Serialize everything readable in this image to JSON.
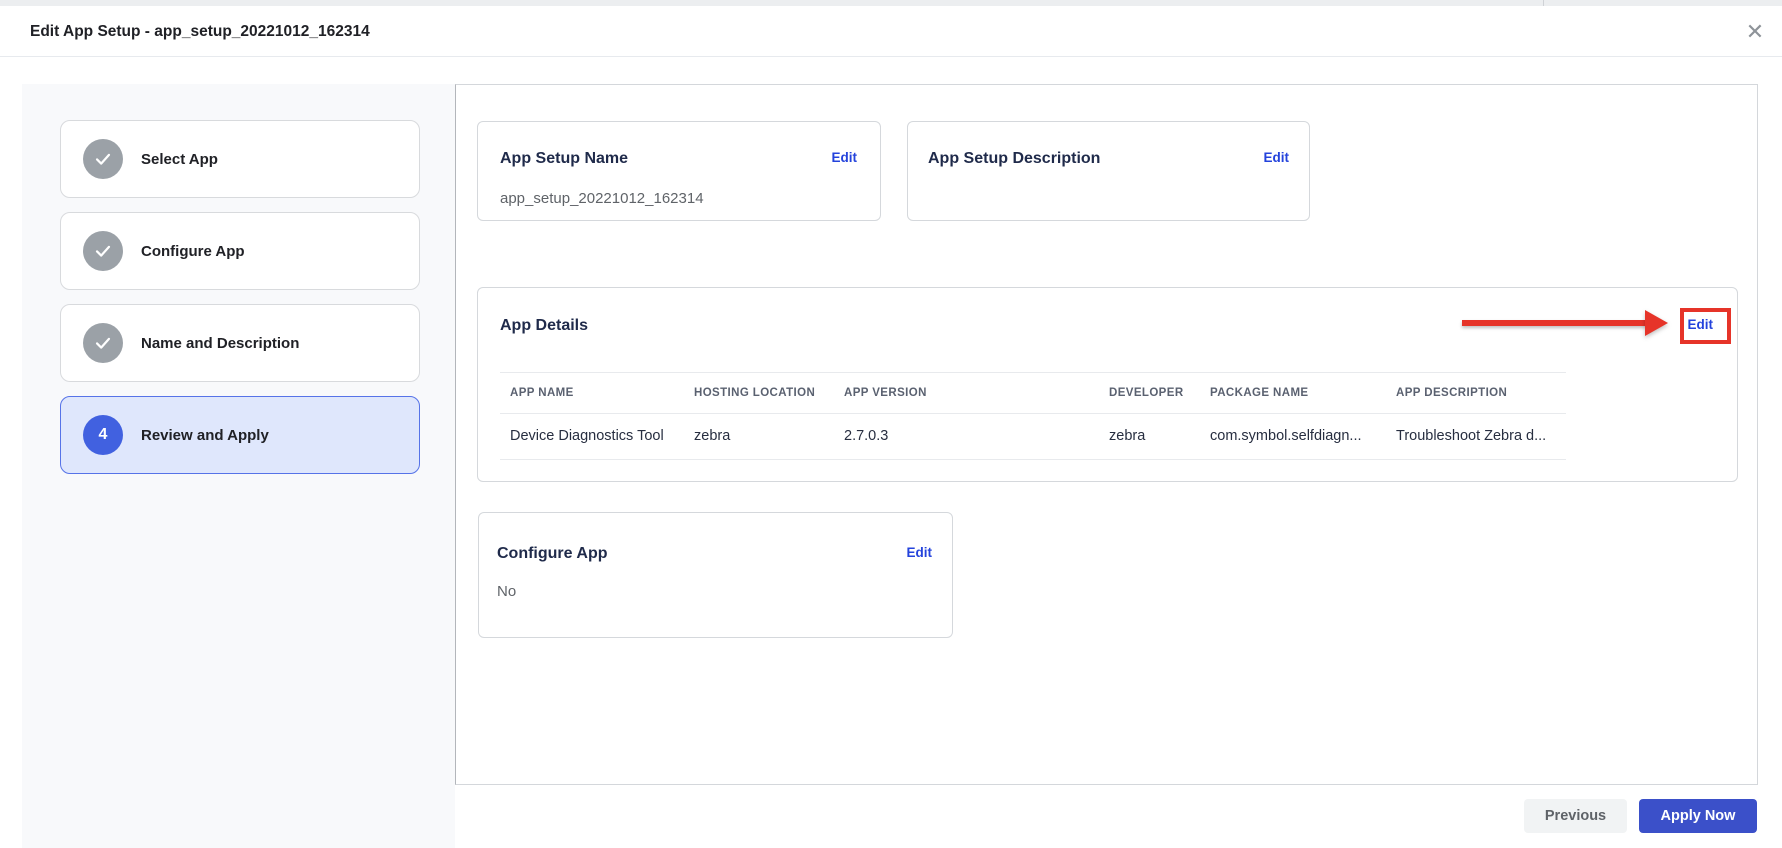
{
  "header": {
    "title": "Edit App Setup - app_setup_20221012_162314",
    "close_icon": "✕"
  },
  "stepper": {
    "steps": [
      {
        "label": "Select App",
        "status": "complete",
        "icon": "check-icon"
      },
      {
        "label": "Configure App",
        "status": "complete",
        "icon": "check-icon"
      },
      {
        "label": "Name and Description",
        "status": "complete",
        "icon": "check-icon"
      },
      {
        "label": "Review and Apply",
        "status": "active",
        "number": "4"
      }
    ]
  },
  "cards": {
    "app_setup_name": {
      "title": "App Setup Name",
      "edit_label": "Edit",
      "value": "app_setup_20221012_162314"
    },
    "app_setup_description": {
      "title": "App Setup Description",
      "edit_label": "Edit",
      "value": ""
    },
    "app_details": {
      "title": "App Details",
      "edit_label": "Edit",
      "table": {
        "columns": [
          "APP NAME",
          "HOSTING LOCATION",
          "APP VERSION",
          "DEVELOPER",
          "PACKAGE NAME",
          "APP DESCRIPTION"
        ],
        "rows": [
          [
            "Device Diagnostics Tool",
            "zebra",
            "2.7.0.3",
            "zebra",
            "com.symbol.selfdiagn...",
            "Troubleshoot Zebra d..."
          ]
        ]
      }
    },
    "configure_app": {
      "title": "Configure App",
      "edit_label": "Edit",
      "value": "No"
    }
  },
  "footer": {
    "previous_label": "Previous",
    "apply_label": "Apply Now"
  },
  "annotation": {
    "type": "red-arrow-pointing-to-edit",
    "color": "#e63429"
  },
  "colors": {
    "accent_blue": "#3b50c9",
    "link_blue": "#2443dc",
    "step_active_blue": "#4161e0",
    "step_active_bg": "#dfe7fc",
    "sidebar_bg": "#f8f9fb",
    "annotation_red": "#e63429"
  }
}
